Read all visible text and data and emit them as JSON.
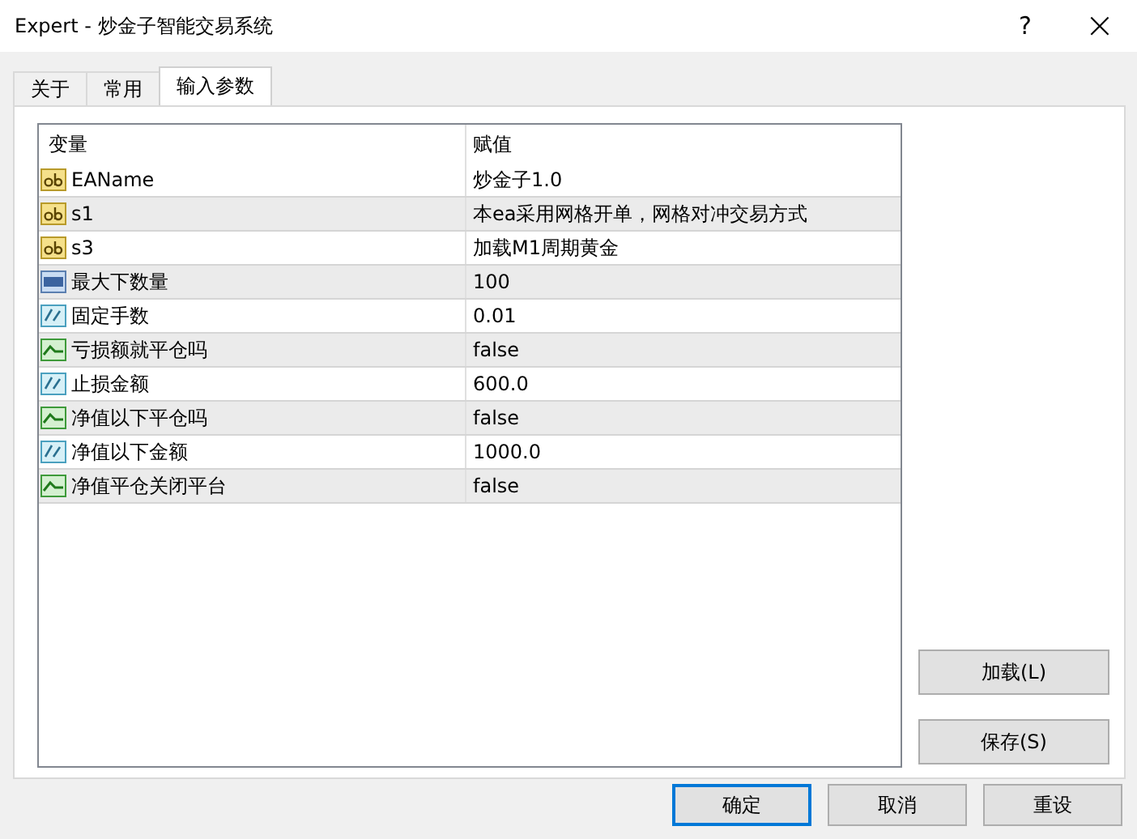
{
  "window": {
    "title": "Expert - 炒金子智能交易系统",
    "help": "?",
    "close": "×"
  },
  "tabs": [
    {
      "label": "关于",
      "selected": false
    },
    {
      "label": "常用",
      "selected": false
    },
    {
      "label": "输入参数",
      "selected": true
    }
  ],
  "table": {
    "columns": [
      "变量",
      "赋值"
    ],
    "rows": [
      {
        "kind": "string",
        "name": "EAName",
        "value": "炒金子1.0"
      },
      {
        "kind": "string",
        "name": "s1",
        "value": "本ea采用网格开单，网格对冲交易方式"
      },
      {
        "kind": "string",
        "name": "s3",
        "value": "加载M1周期黄金"
      },
      {
        "kind": "int",
        "name": "最大下数量",
        "value": "100"
      },
      {
        "kind": "double",
        "name": "固定手数",
        "value": "0.01"
      },
      {
        "kind": "bool",
        "name": "亏损额就平仓吗",
        "value": "false"
      },
      {
        "kind": "double",
        "name": "止损金额",
        "value": "600.0"
      },
      {
        "kind": "bool",
        "name": "净值以下平仓吗",
        "value": "false"
      },
      {
        "kind": "double",
        "name": "净值以下金额",
        "value": "1000.0"
      },
      {
        "kind": "bool",
        "name": "净值平仓关闭平台",
        "value": "false"
      }
    ]
  },
  "side_buttons": [
    "加载(L)",
    "保存(S)"
  ],
  "buttons": [
    {
      "label": "确定",
      "selected": true
    },
    {
      "label": "取消",
      "selected": false
    },
    {
      "label": "重设",
      "selected": false
    }
  ]
}
